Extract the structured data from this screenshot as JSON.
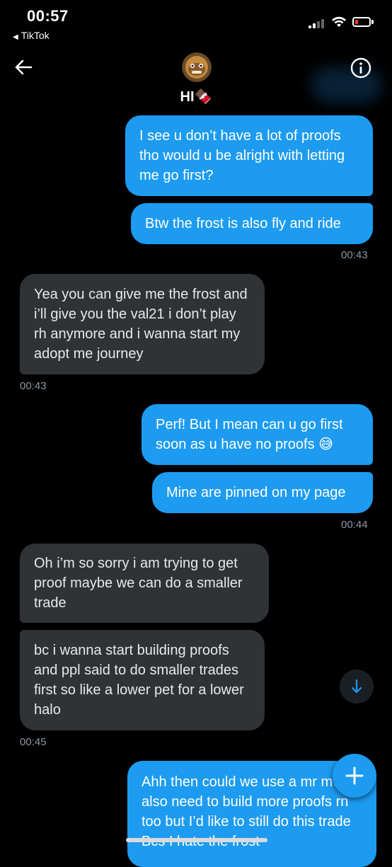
{
  "status_bar": {
    "time": "00:57",
    "back_app": "TikTok",
    "battery_color": "#ff3b30"
  },
  "header": {
    "contact_name": "HI🍫",
    "back_icon": "arrow-left-icon",
    "info_icon": "info-icon"
  },
  "messages": [
    {
      "type": "sent",
      "text": "I see u don’t have a lot of proofs tho would u be alright with letting me go first?"
    },
    {
      "type": "sent",
      "text": "Btw the frost is also fly and ride",
      "time": "00:43"
    },
    {
      "type": "received",
      "text": "Yea you can give me the frost and i’ll give you the val21 i don’t play rh anymore and i wanna start my adopt me journey",
      "time": "00:43"
    },
    {
      "type": "sent",
      "text": "Perf! But I mean can u go first soon as u have no proofs 😅"
    },
    {
      "type": "sent",
      "text": "Mine are pinned on my page",
      "time": "00:44"
    },
    {
      "type": "received",
      "text": "Oh i’m so sorry i am trying to get proof maybe we can do a smaller trade"
    },
    {
      "type": "received",
      "text": "bc i wanna start building proofs and ppl said to do smaller trades first so like a lower pet for a lower halo",
      "time": "00:45"
    },
    {
      "type": "sent",
      "text": "Ahh then could we use a mr mw I also need to build more proofs rn too but I’d like to still do this trade Bcs I hate the frost"
    }
  ],
  "colors": {
    "sent_bubble": "#1d9bf0",
    "received_bubble": "#2f3336",
    "background": "#000000",
    "timestamp": "#8b98a5"
  },
  "controls": {
    "scroll_down_icon": "arrow-down-icon",
    "compose_icon": "plus-icon"
  }
}
